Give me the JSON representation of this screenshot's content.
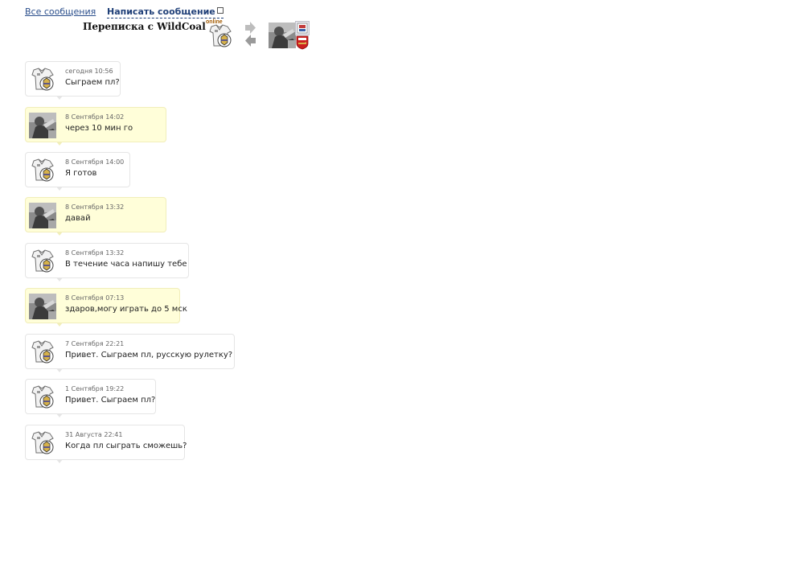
{
  "nav": {
    "all_messages": "Все сообщения",
    "write_message": "Написать сообщение"
  },
  "header": {
    "title": "Переписка с WildCoal",
    "online_status": "online"
  },
  "icons": {
    "me_avatar": "real-madrid-jersey-avatar",
    "them_avatar": "grayscale-photo-avatar",
    "their_club": "arsenal-crest",
    "next_arrow": "arrow-right-icon",
    "prev_arrow": "arrow-left-icon"
  },
  "colors": {
    "incoming_bg": "#fffed9",
    "outgoing_bg": "#ffffff",
    "link": "#2b4f8c"
  },
  "messages": [
    {
      "author": "me",
      "time": "сегодня 10:56",
      "text": "Сыграем пл?"
    },
    {
      "author": "them",
      "time": "8 Сентября 14:02",
      "text": "через 10 мин го"
    },
    {
      "author": "me",
      "time": "8 Сентября 14:00",
      "text": "Я готов"
    },
    {
      "author": "them",
      "time": "8 Сентября 13:32",
      "text": "давай"
    },
    {
      "author": "me",
      "time": "8 Сентября 13:32",
      "text": "В течение часа напишу тебе"
    },
    {
      "author": "them",
      "time": "8 Сентября 07:13",
      "text": "здаров,могу играть до 5 мск"
    },
    {
      "author": "me",
      "time": "7 Сентября 22:21",
      "text": "Привет. Сыграем пл, русскую рулетку?"
    },
    {
      "author": "me",
      "time": "1 Сентября 19:22",
      "text": "Привет. Сыграем пл?"
    },
    {
      "author": "me",
      "time": "31 Августа 22:41",
      "text": "Когда пл сыграть сможешь?"
    }
  ]
}
